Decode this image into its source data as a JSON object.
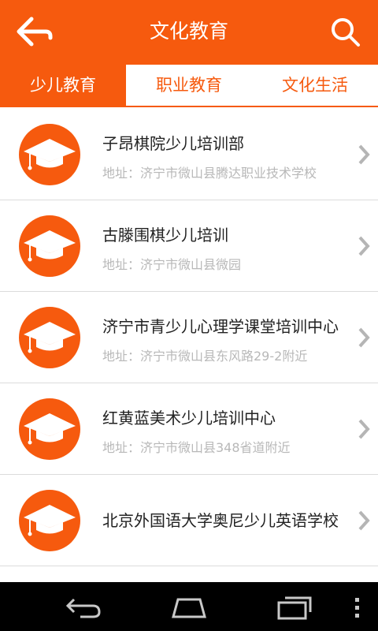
{
  "header": {
    "title": "文化教育",
    "back_icon": "back-arrow-icon",
    "search_icon": "search-icon",
    "accent_color": "#f65a0e"
  },
  "tabs": [
    {
      "label": "少儿教育",
      "active": true
    },
    {
      "label": "职业教育",
      "active": false
    },
    {
      "label": "文化生活",
      "active": false
    }
  ],
  "list": {
    "item_icon": "graduation-cap-icon",
    "items": [
      {
        "name": "子昂棋院少儿培训部",
        "address": "地址：济宁市微山县腾达职业技术学校"
      },
      {
        "name": "古滕围棋少儿培训",
        "address": "地址：济宁市微山县微园"
      },
      {
        "name": "济宁市青少儿心理学课堂培训中心",
        "address": "地址：济宁市微山县东风路29-2附近"
      },
      {
        "name": "红黄蓝美术少儿培训中心",
        "address": "地址：济宁市微山县348省道附近"
      },
      {
        "name": "北京外国语大学奥尼少儿英语学校",
        "address": ""
      }
    ]
  },
  "navbar": {
    "icons": [
      "back-nav-icon",
      "home-nav-icon",
      "recent-apps-icon",
      "overflow-menu-icon"
    ]
  }
}
